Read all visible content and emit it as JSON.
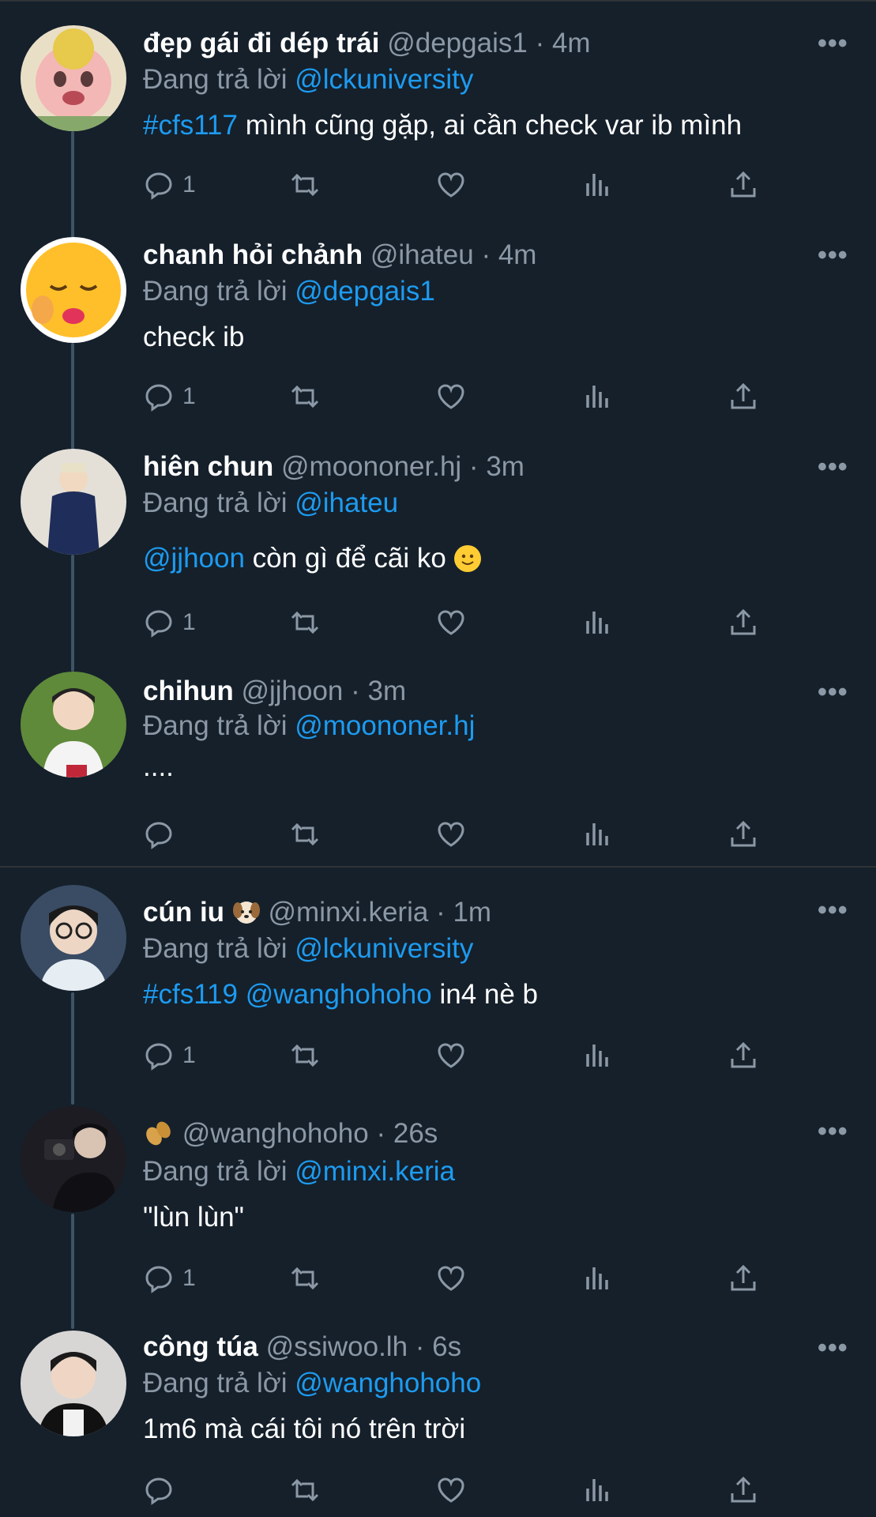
{
  "reply_prefix": "Đang trả lời",
  "tweets": [
    {
      "name": "đẹp gái đi dép trái",
      "handle": "@depgais1",
      "time": "4m",
      "reply_to": "@lckuniversity",
      "body_tag": "#cfs117",
      "body_text": " mình cũng gặp, ai cần check var ib mình",
      "replies": "1"
    },
    {
      "name": "chanh hỏi chảnh",
      "handle": "@ihateu",
      "time": "4m",
      "reply_to": "@depgais1",
      "body_text": "check ib",
      "replies": "1"
    },
    {
      "name": "hiên chun",
      "handle": "@moononer.hj",
      "time": "3m",
      "reply_to": "@ihateu",
      "body_mention": "@jjhoon",
      "body_text": " còn gì để cãi ko",
      "body_emoji": "slightly-smiling-face",
      "replies": "1"
    },
    {
      "name": "chihun",
      "handle": "@jjhoon",
      "time": "3m",
      "reply_to": "@moononer.hj",
      "body_text": "....",
      "replies": ""
    },
    {
      "name": "cún iu",
      "name_emoji": "dog-face",
      "handle": "@minxi.keria",
      "time": "1m",
      "reply_to": "@lckuniversity",
      "body_tag": "#cfs119",
      "body_mention": "@wanghohoho",
      "body_text": " in4 nè b",
      "replies": "1"
    },
    {
      "name_emoji": "peanuts",
      "handle": "@wanghohoho",
      "time": "26s",
      "reply_to": "@minxi.keria",
      "body_text": "\"lùn lùn\"",
      "replies": "1"
    },
    {
      "name": "công túa",
      "handle": "@ssiwoo.lh",
      "time": "6s",
      "reply_to": "@wanghohoho",
      "body_text": "1m6 mà cái tôi nó trên trời",
      "replies": ""
    }
  ],
  "separator": "·",
  "more_glyph": "•••",
  "colors": {
    "background": "#15202b",
    "accent": "#1d9bf0",
    "muted": "#8b98a5",
    "divider": "#2f3336"
  }
}
